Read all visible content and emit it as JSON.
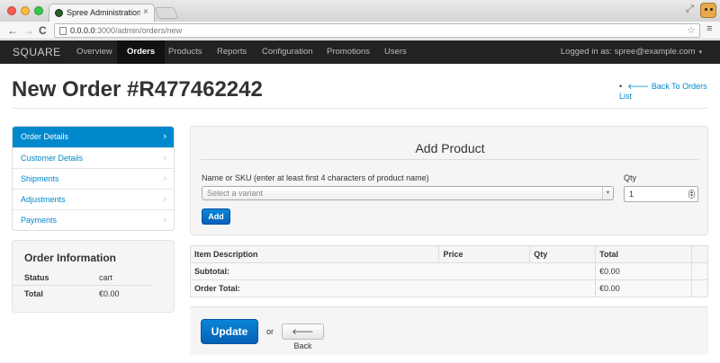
{
  "browser": {
    "tab_title": "Spree Administration: Ord",
    "tab_close": "×",
    "url_host": "0.0.0.0",
    "url_rest": ":3000/admin/orders/new",
    "back_glyph": "←",
    "forward_glyph": "→",
    "reload_glyph": "C",
    "star_glyph": "☆",
    "menu_glyph": "≡",
    "fullscreen_glyph": "⤢"
  },
  "navbar": {
    "brand": "SQUARE",
    "items": [
      {
        "label": "Overview"
      },
      {
        "label": "Orders",
        "active": true
      },
      {
        "label": "Products"
      },
      {
        "label": "Reports"
      },
      {
        "label": "Configuration"
      },
      {
        "label": "Promotions"
      },
      {
        "label": "Users"
      }
    ],
    "logged_in": "Logged in as: spree@example.com",
    "caret": "▾"
  },
  "page": {
    "title": "New Order #R477462242",
    "back_link": "Back To Orders List",
    "back_arrow": "🡐",
    "bullet": "•"
  },
  "sidebar": {
    "items": [
      {
        "label": "Order Details",
        "active": true
      },
      {
        "label": "Customer Details"
      },
      {
        "label": "Shipments"
      },
      {
        "label": "Adjustments"
      },
      {
        "label": "Payments"
      }
    ],
    "chevron": "›"
  },
  "order_info": {
    "title": "Order Information",
    "status_label": "Status",
    "status_value": "cart",
    "total_label": "Total",
    "total_value": "€0.00"
  },
  "add_product": {
    "title": "Add Product",
    "variant_label": "Name or SKU (enter at least first 4 characters of product name)",
    "variant_placeholder": "Select a variant",
    "qty_label": "Qty",
    "qty_value": "1",
    "add_button": "Add"
  },
  "items_table": {
    "headers": [
      "Item Description",
      "Price",
      "Qty",
      "Total"
    ],
    "subtotal_label": "Subtotal:",
    "subtotal_value": "€0.00",
    "order_total_label": "Order Total:",
    "order_total_value": "€0.00"
  },
  "actions": {
    "update_button": "Update",
    "or_text": "or",
    "back_button": "Back",
    "back_arrow": "🡐"
  }
}
